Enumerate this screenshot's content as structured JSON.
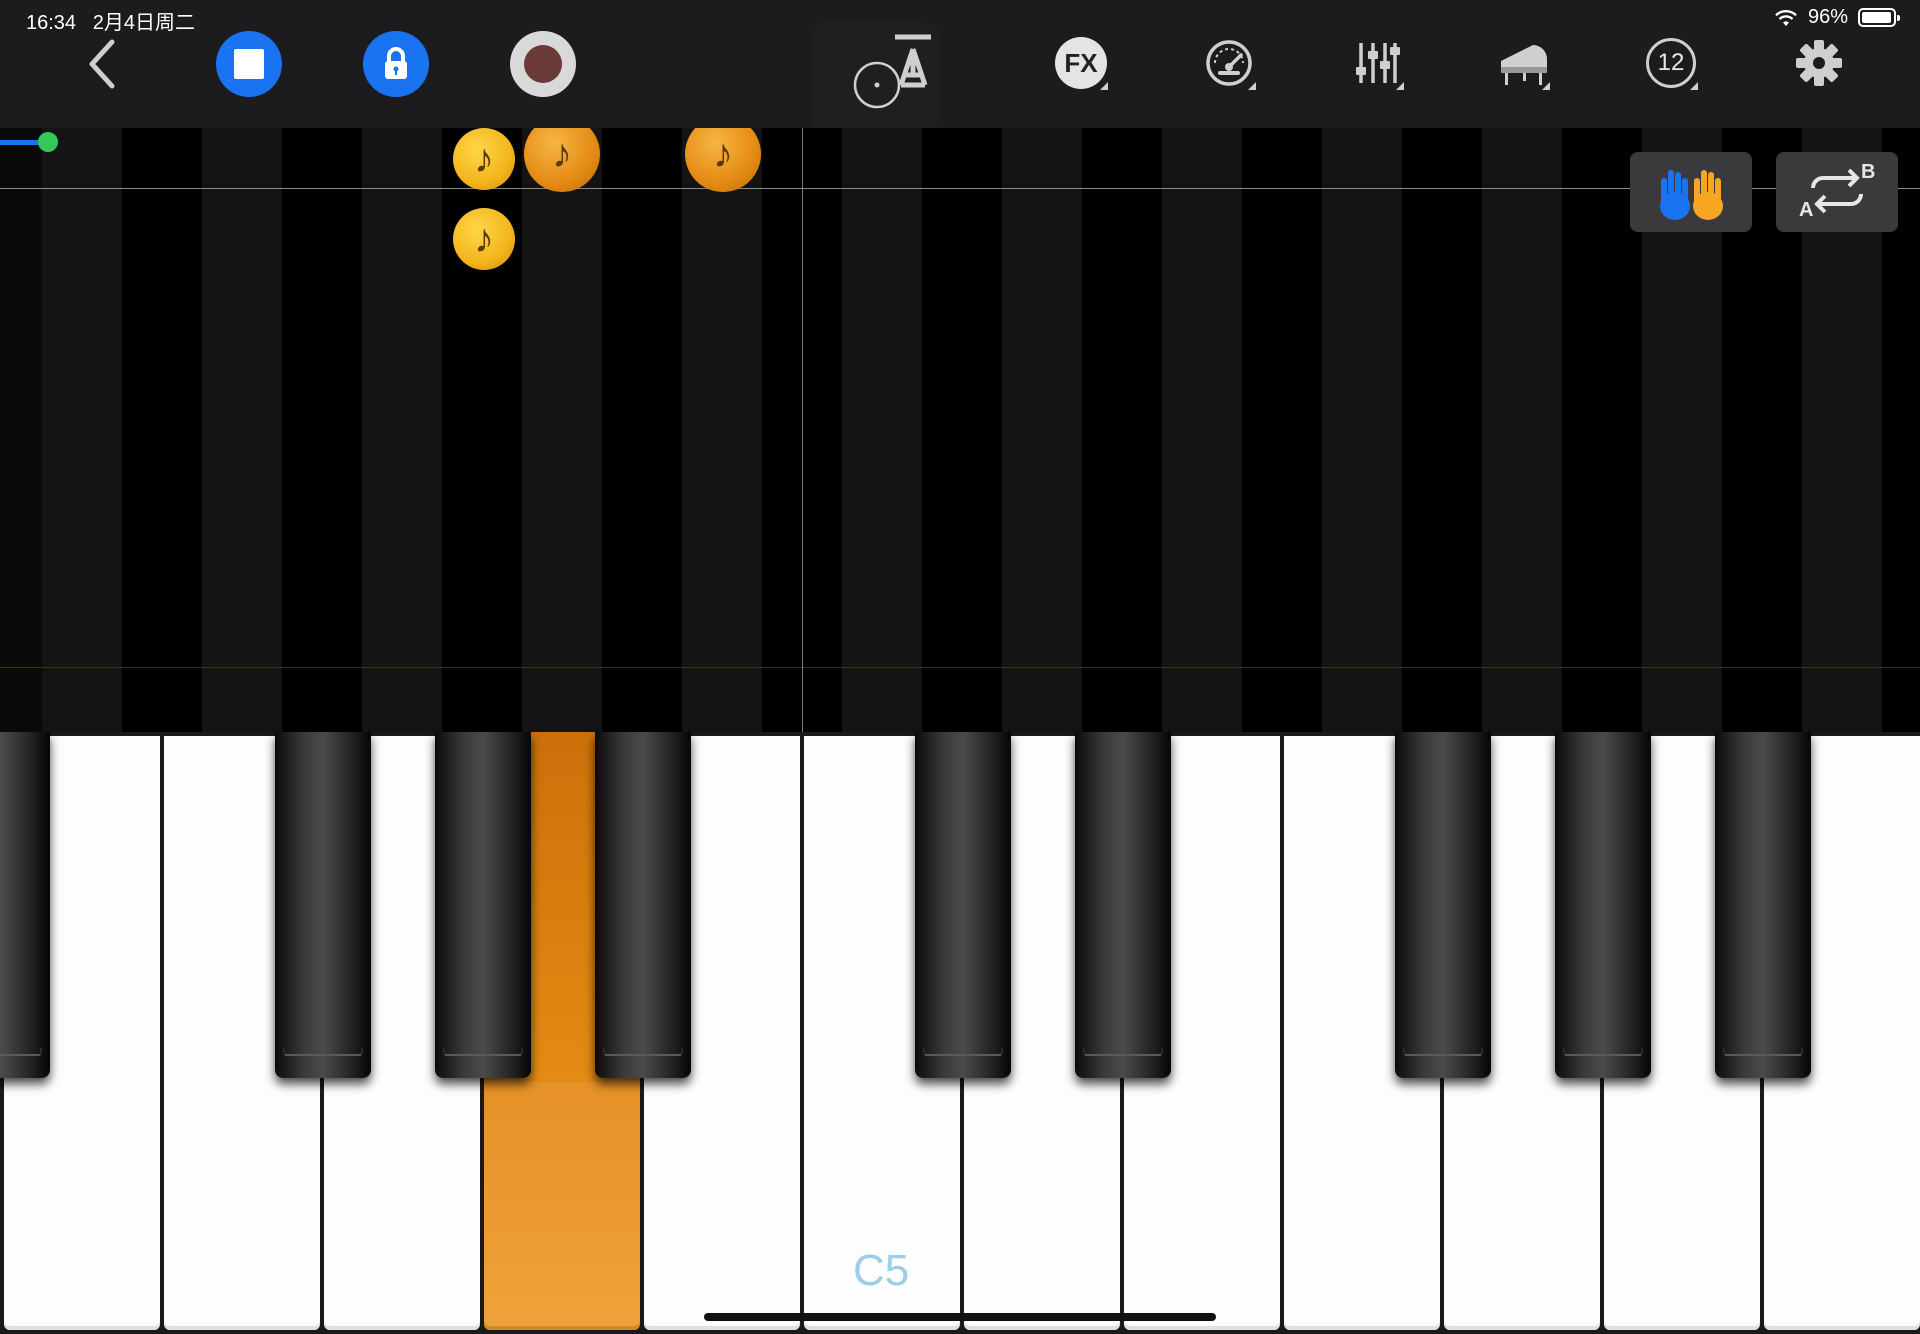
{
  "status": {
    "time": "16:34",
    "date": "2月4日周二",
    "battery_text": "96%",
    "battery_level": 0.96
  },
  "toolbar": {
    "icons": [
      "back-chevron-icon",
      "stop-icon",
      "lock-icon",
      "record-icon",
      "metronome-icon",
      "fx-icon",
      "speed-gauge-icon",
      "mixer-icon",
      "piano-instrument-icon",
      "transpose-icon",
      "gear-icon"
    ],
    "fx_label": "FX",
    "transpose_value": "12"
  },
  "roll": {
    "progress": 0.025,
    "colors": {
      "note_light": "#f3b51c",
      "note_dark": "#e48b14",
      "playhead": "#7a7a7a",
      "progress": "#1a74f2",
      "progress_knob": "#34c759"
    }
  },
  "side_buttons": {
    "hands_icon": "two-hands-icon",
    "ab_loop_icon": "ab-repeat-icon",
    "ab_a": "A",
    "ab_b": "B"
  },
  "keyboard": {
    "octave_label": "C5",
    "active_key_color": "#f0a23a",
    "note_glyph": "♪"
  }
}
